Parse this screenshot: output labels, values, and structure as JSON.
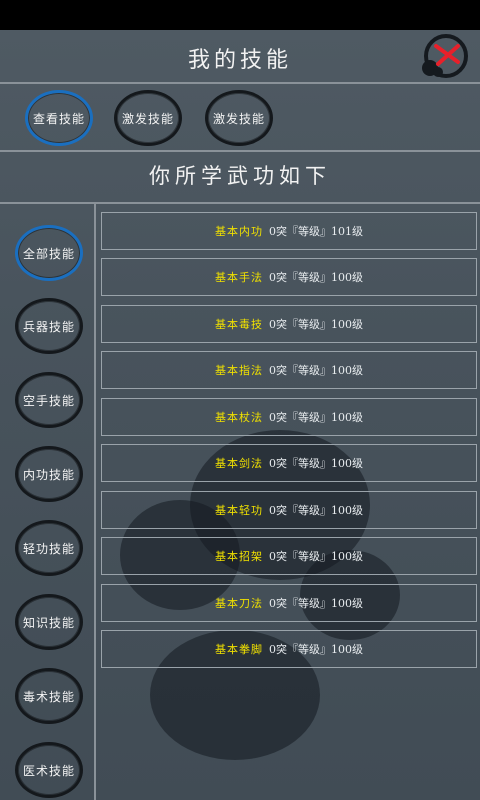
{
  "header": {
    "title": "我的技能"
  },
  "top_tabs": [
    {
      "label": "查看技能",
      "active": true
    },
    {
      "label": "激发技能",
      "active": false
    },
    {
      "label": "激发技能",
      "active": false
    }
  ],
  "subtitle": "你所学武功如下",
  "categories": [
    {
      "label": "全部技能",
      "active": true
    },
    {
      "label": "兵器技能",
      "active": false
    },
    {
      "label": "空手技能",
      "active": false
    },
    {
      "label": "内功技能",
      "active": false
    },
    {
      "label": "轻功技能",
      "active": false
    },
    {
      "label": "知识技能",
      "active": false
    },
    {
      "label": "毒术技能",
      "active": false
    },
    {
      "label": "医术技能",
      "active": false
    }
  ],
  "skills": [
    {
      "name": "基本内功",
      "info": "0突『等级』101级"
    },
    {
      "name": "基本手法",
      "info": "0突『等级』100级"
    },
    {
      "name": "基本毒技",
      "info": "0突『等级』100级"
    },
    {
      "name": "基本指法",
      "info": "0突『等级』100级"
    },
    {
      "name": "基本杖法",
      "info": "0突『等级』100级"
    },
    {
      "name": "基本剑法",
      "info": "0突『等级』100级"
    },
    {
      "name": "基本轻功",
      "info": "0突『等级』100级"
    },
    {
      "name": "基本招架",
      "info": "0突『等级』100级"
    },
    {
      "name": "基本刀法",
      "info": "0突『等级』100级"
    },
    {
      "name": "基本拳脚",
      "info": "0突『等级』100级"
    }
  ],
  "colors": {
    "active_ring": "#1a6fc0",
    "skill_name": "#f0e000",
    "close_x": "#e8202a"
  },
  "icons": {
    "close": "close-icon"
  }
}
